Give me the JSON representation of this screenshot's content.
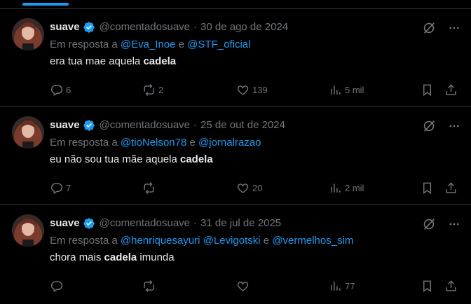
{
  "tweets": [
    {
      "name": "suave",
      "handle": "@comentadosuave",
      "separator": "·",
      "date": "30 de ago de 2024",
      "reply_prefix": "Em resposta a",
      "reply_targets": [
        "@Eva_Inoe",
        "@STF_oficial"
      ],
      "reply_joiners": [
        "e"
      ],
      "text_before": "era tua mae aquela",
      "text_bold": "cadela",
      "text_after": "",
      "replies": "6",
      "reposts": "2",
      "likes": "139",
      "views": "5 mil"
    },
    {
      "name": "suave",
      "handle": "@comentadosuave",
      "separator": "·",
      "date": "25 de out de 2024",
      "reply_prefix": "Em resposta a",
      "reply_targets": [
        "@tioNelson78",
        "@jornalrazao"
      ],
      "reply_joiners": [
        "e"
      ],
      "text_before": "eu não sou tua mãe aquela",
      "text_bold": "cadela",
      "text_after": "",
      "replies": "7",
      "reposts": "",
      "likes": "20",
      "views": "2 mil"
    },
    {
      "name": "suave",
      "handle": "@comentadosuave",
      "separator": "·",
      "date": "31 de jul de 2025",
      "reply_prefix": "Em resposta a",
      "reply_targets": [
        "@henriquesayuri",
        "@Levigotski",
        "@vermelhos_sim"
      ],
      "reply_joiners": [
        "",
        "e"
      ],
      "text_before": "chora mais",
      "text_bold": "cadela",
      "text_after": "imunda",
      "replies": "",
      "reposts": "",
      "likes": "",
      "views": "77"
    }
  ],
  "icons": {
    "verified": "verified-badge-icon",
    "grok": "grok-icon",
    "more": "more-icon",
    "reply": "reply-icon",
    "repost": "repost-icon",
    "like": "like-icon",
    "views": "views-icon",
    "bookmark": "bookmark-icon",
    "share": "share-icon"
  },
  "colors": {
    "background": "#000000",
    "text": "#e7e9ea",
    "muted": "#71767b",
    "accent": "#1d9bf0",
    "divider": "#2f3336"
  }
}
